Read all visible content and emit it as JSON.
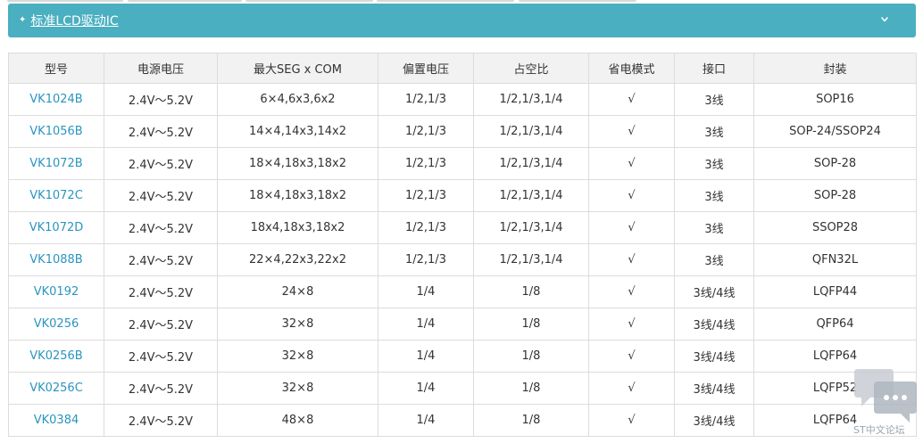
{
  "panel": {
    "title": "标准LCD驱动IC"
  },
  "table": {
    "headers": [
      "型号",
      "电源电压",
      "最大SEG x COM",
      "偏置电压",
      "占空比",
      "省电模式",
      "接口",
      "封装"
    ],
    "rows": [
      [
        "VK1024B",
        "2.4V～5.2V",
        "6×4,6x3,6x2",
        "1/2,1/3",
        "1/2,1/3,1/4",
        "√",
        "3线",
        "SOP16"
      ],
      [
        "VK1056B",
        "2.4V～5.2V",
        "14×4,14x3,14x2",
        "1/2,1/3",
        "1/2,1/3,1/4",
        "√",
        "3线",
        "SOP-24/SSOP24"
      ],
      [
        "VK1072B",
        "2.4V～5.2V",
        "18×4,18x3,18x2",
        "1/2,1/3",
        "1/2,1/3,1/4",
        "√",
        "3线",
        "SOP-28"
      ],
      [
        "VK1072C",
        "2.4V～5.2V",
        "18×4,18x3,18x2",
        "1/2,1/3",
        "1/2,1/3,1/4",
        "√",
        "3线",
        "SOP-28"
      ],
      [
        "VK1072D",
        "2.4V～5.2V",
        "18x4,18x3,18x2",
        "1/2,1/3",
        "1/2,1/3,1/4",
        "√",
        "3线",
        "SSOP28"
      ],
      [
        "VK1088B",
        "2.4V～5.2V",
        "22×4,22x3,22x2",
        "1/2,1/3",
        "1/2,1/3,1/4",
        "√",
        "3线",
        "QFN32L"
      ],
      [
        "VK0192",
        "2.4V～5.2V",
        "24×8",
        "1/4",
        "1/8",
        "√",
        "3线/4线",
        "LQFP44"
      ],
      [
        "VK0256",
        "2.4V～5.2V",
        "32×8",
        "1/4",
        "1/8",
        "√",
        "3线/4线",
        "QFP64"
      ],
      [
        "VK0256B",
        "2.4V～5.2V",
        "32×8",
        "1/4",
        "1/8",
        "√",
        "3线/4线",
        "LQFP64"
      ],
      [
        "VK0256C",
        "2.4V～5.2V",
        "32×8",
        "1/4",
        "1/8",
        "√",
        "3线/4线",
        "LQFP52"
      ],
      [
        "VK0384",
        "2.4V～5.2V",
        "48×8",
        "1/4",
        "1/8",
        "√",
        "3线/4线",
        "LQFP64"
      ]
    ]
  },
  "watermark": {
    "text": "ST中文论坛"
  },
  "colors": {
    "header_bar": "#4aafc0",
    "model_link": "#2a95c0",
    "table_header_bg": "#f2f2f2",
    "border": "#dcdcdc"
  },
  "icons": {
    "title_marker": "diamond-icon",
    "collapse": "chevron-down-icon",
    "watermark_logo": "chat-bubbles-icon"
  }
}
